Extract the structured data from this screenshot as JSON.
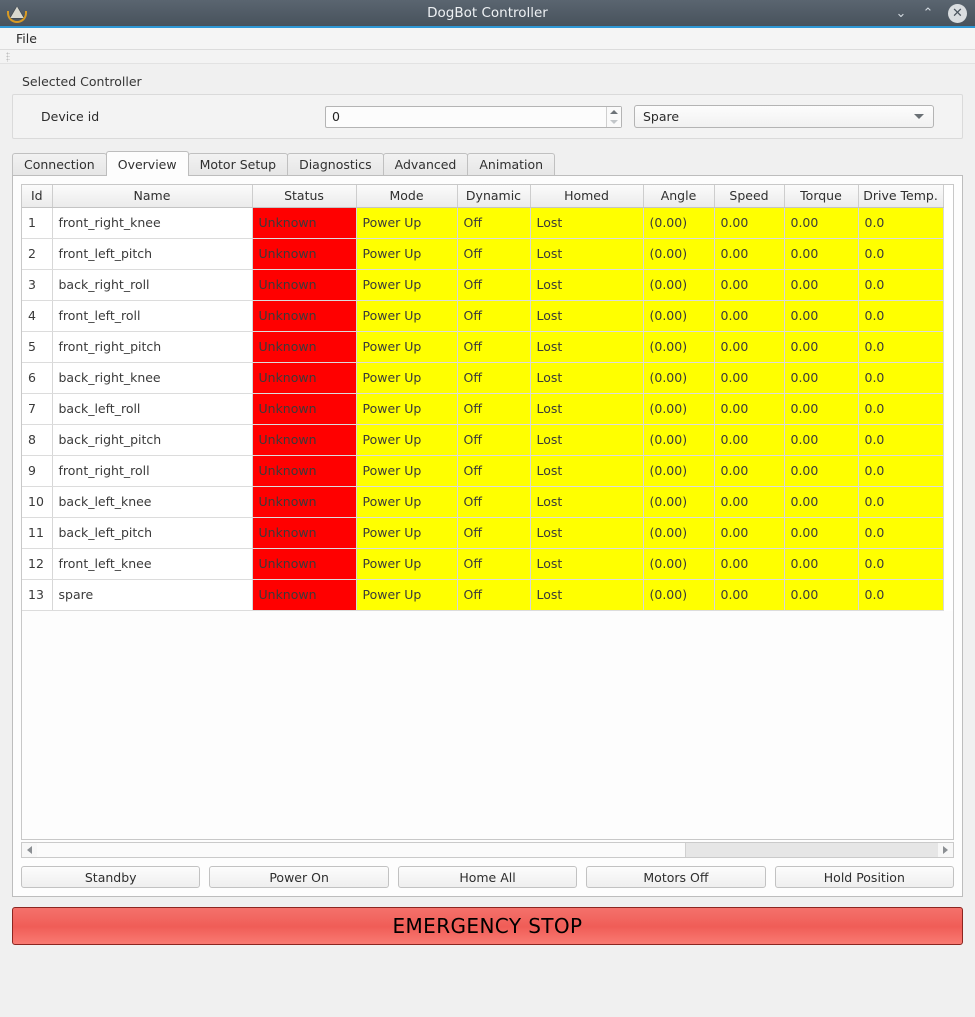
{
  "window": {
    "title": "DogBot Controller",
    "app_icon": "dogbot-app-icon",
    "minimize_label": "⌄",
    "maximize_label": "⌃",
    "close_label": "✕"
  },
  "menubar": {
    "items": [
      {
        "label": "File"
      }
    ]
  },
  "controller": {
    "group_label": "Selected Controller",
    "device_id_label": "Device id",
    "device_id_value": "0",
    "device_id_placeholder": "0",
    "device_select_value": "Spare"
  },
  "tabs": [
    {
      "label": "Connection",
      "active": false
    },
    {
      "label": "Overview",
      "active": true
    },
    {
      "label": "Motor Setup",
      "active": false
    },
    {
      "label": "Diagnostics",
      "active": false
    },
    {
      "label": "Advanced",
      "active": false
    },
    {
      "label": "Animation",
      "active": false
    }
  ],
  "table": {
    "columns": [
      "Id",
      "Name",
      "Status",
      "Mode",
      "Dynamic",
      "Homed",
      "Angle",
      "Speed",
      "Torque",
      "Drive Temp."
    ],
    "rows": [
      {
        "id": "1",
        "name": "front_right_knee",
        "status": "Unknown",
        "mode": "Power Up",
        "dynamic": "Off",
        "homed": "Lost",
        "angle": "(0.00)",
        "speed": "0.00",
        "torque": "0.00",
        "temp": "0.0"
      },
      {
        "id": "2",
        "name": "front_left_pitch",
        "status": "Unknown",
        "mode": "Power Up",
        "dynamic": "Off",
        "homed": "Lost",
        "angle": "(0.00)",
        "speed": "0.00",
        "torque": "0.00",
        "temp": "0.0"
      },
      {
        "id": "3",
        "name": "back_right_roll",
        "status": "Unknown",
        "mode": "Power Up",
        "dynamic": "Off",
        "homed": "Lost",
        "angle": "(0.00)",
        "speed": "0.00",
        "torque": "0.00",
        "temp": "0.0"
      },
      {
        "id": "4",
        "name": "front_left_roll",
        "status": "Unknown",
        "mode": "Power Up",
        "dynamic": "Off",
        "homed": "Lost",
        "angle": "(0.00)",
        "speed": "0.00",
        "torque": "0.00",
        "temp": "0.0"
      },
      {
        "id": "5",
        "name": "front_right_pitch",
        "status": "Unknown",
        "mode": "Power Up",
        "dynamic": "Off",
        "homed": "Lost",
        "angle": "(0.00)",
        "speed": "0.00",
        "torque": "0.00",
        "temp": "0.0"
      },
      {
        "id": "6",
        "name": "back_right_knee",
        "status": "Unknown",
        "mode": "Power Up",
        "dynamic": "Off",
        "homed": "Lost",
        "angle": "(0.00)",
        "speed": "0.00",
        "torque": "0.00",
        "temp": "0.0"
      },
      {
        "id": "7",
        "name": "back_left_roll",
        "status": "Unknown",
        "mode": "Power Up",
        "dynamic": "Off",
        "homed": "Lost",
        "angle": "(0.00)",
        "speed": "0.00",
        "torque": "0.00",
        "temp": "0.0"
      },
      {
        "id": "8",
        "name": "back_right_pitch",
        "status": "Unknown",
        "mode": "Power Up",
        "dynamic": "Off",
        "homed": "Lost",
        "angle": "(0.00)",
        "speed": "0.00",
        "torque": "0.00",
        "temp": "0.0"
      },
      {
        "id": "9",
        "name": "front_right_roll",
        "status": "Unknown",
        "mode": "Power Up",
        "dynamic": "Off",
        "homed": "Lost",
        "angle": "(0.00)",
        "speed": "0.00",
        "torque": "0.00",
        "temp": "0.0"
      },
      {
        "id": "10",
        "name": "back_left_knee",
        "status": "Unknown",
        "mode": "Power Up",
        "dynamic": "Off",
        "homed": "Lost",
        "angle": "(0.00)",
        "speed": "0.00",
        "torque": "0.00",
        "temp": "0.0"
      },
      {
        "id": "11",
        "name": "back_left_pitch",
        "status": "Unknown",
        "mode": "Power Up",
        "dynamic": "Off",
        "homed": "Lost",
        "angle": "(0.00)",
        "speed": "0.00",
        "torque": "0.00",
        "temp": "0.0"
      },
      {
        "id": "12",
        "name": "front_left_knee",
        "status": "Unknown",
        "mode": "Power Up",
        "dynamic": "Off",
        "homed": "Lost",
        "angle": "(0.00)",
        "speed": "0.00",
        "torque": "0.00",
        "temp": "0.0"
      },
      {
        "id": "13",
        "name": "spare",
        "status": "Unknown",
        "mode": "Power Up",
        "dynamic": "Off",
        "homed": "Lost",
        "angle": "(0.00)",
        "speed": "0.00",
        "torque": "0.00",
        "temp": "0.0"
      }
    ]
  },
  "scrollbar": {
    "thumb_percent": "72"
  },
  "actions": [
    {
      "label": "Standby"
    },
    {
      "label": "Power On"
    },
    {
      "label": "Home All"
    },
    {
      "label": "Motors Off"
    },
    {
      "label": "Hold Position"
    }
  ],
  "emergency_stop": {
    "label": "EMERGENCY STOP"
  },
  "colors": {
    "status_bg": "#ff0000",
    "data_bg": "#ffff00",
    "titlebar": "#48525c",
    "accent": "#2f98d6",
    "estop": "#f05d57"
  }
}
